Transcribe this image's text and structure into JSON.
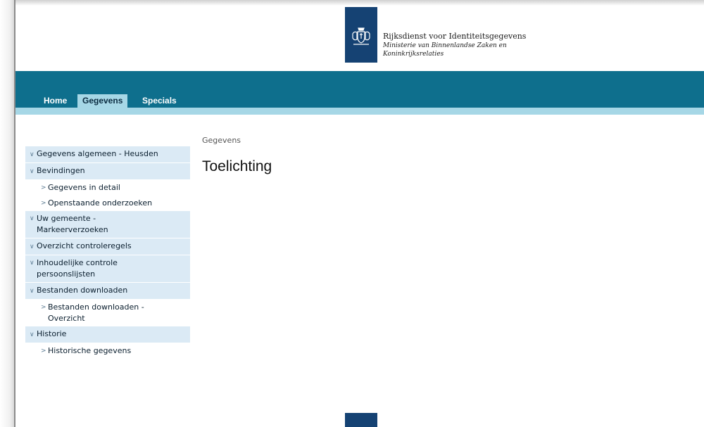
{
  "header": {
    "org_name": "Rijksdienst voor Identiteitsgegevens",
    "ministry_line1": "Ministerie van Binnenlandse Zaken en",
    "ministry_line2": "Koninkrijksrelaties"
  },
  "nav": {
    "tabs": [
      {
        "label": "Home",
        "active": false
      },
      {
        "label": "Gegevens",
        "active": true
      },
      {
        "label": "Specials",
        "active": false
      }
    ]
  },
  "sidebar": {
    "items": [
      {
        "label": "Gegevens algemeen - Heusden",
        "level": "top"
      },
      {
        "label": "Bevindingen",
        "level": "top"
      },
      {
        "label": "Gegevens in detail",
        "level": "sub"
      },
      {
        "label": "Openstaande onderzoeken",
        "level": "sub"
      },
      {
        "label": "Uw gemeente - Markeerverzoeken",
        "level": "top"
      },
      {
        "label": "Overzicht controleregels",
        "level": "top"
      },
      {
        "label": "Inhoudelijke controle persoonslijsten",
        "level": "top"
      },
      {
        "label": "Bestanden downloaden",
        "level": "top"
      },
      {
        "label": "Bestanden downloaden - Overzicht",
        "level": "sub"
      },
      {
        "label": "Historie",
        "level": "top"
      },
      {
        "label": "Historische gegevens",
        "level": "sub"
      }
    ]
  },
  "main": {
    "breadcrumb": "Gegevens",
    "title": "Toelichting"
  },
  "colors": {
    "brand_dark": "#154273",
    "nav_bar": "#0e6f8d",
    "nav_active": "#a6d7e6",
    "sidebar_top": "#dbeaf5"
  }
}
